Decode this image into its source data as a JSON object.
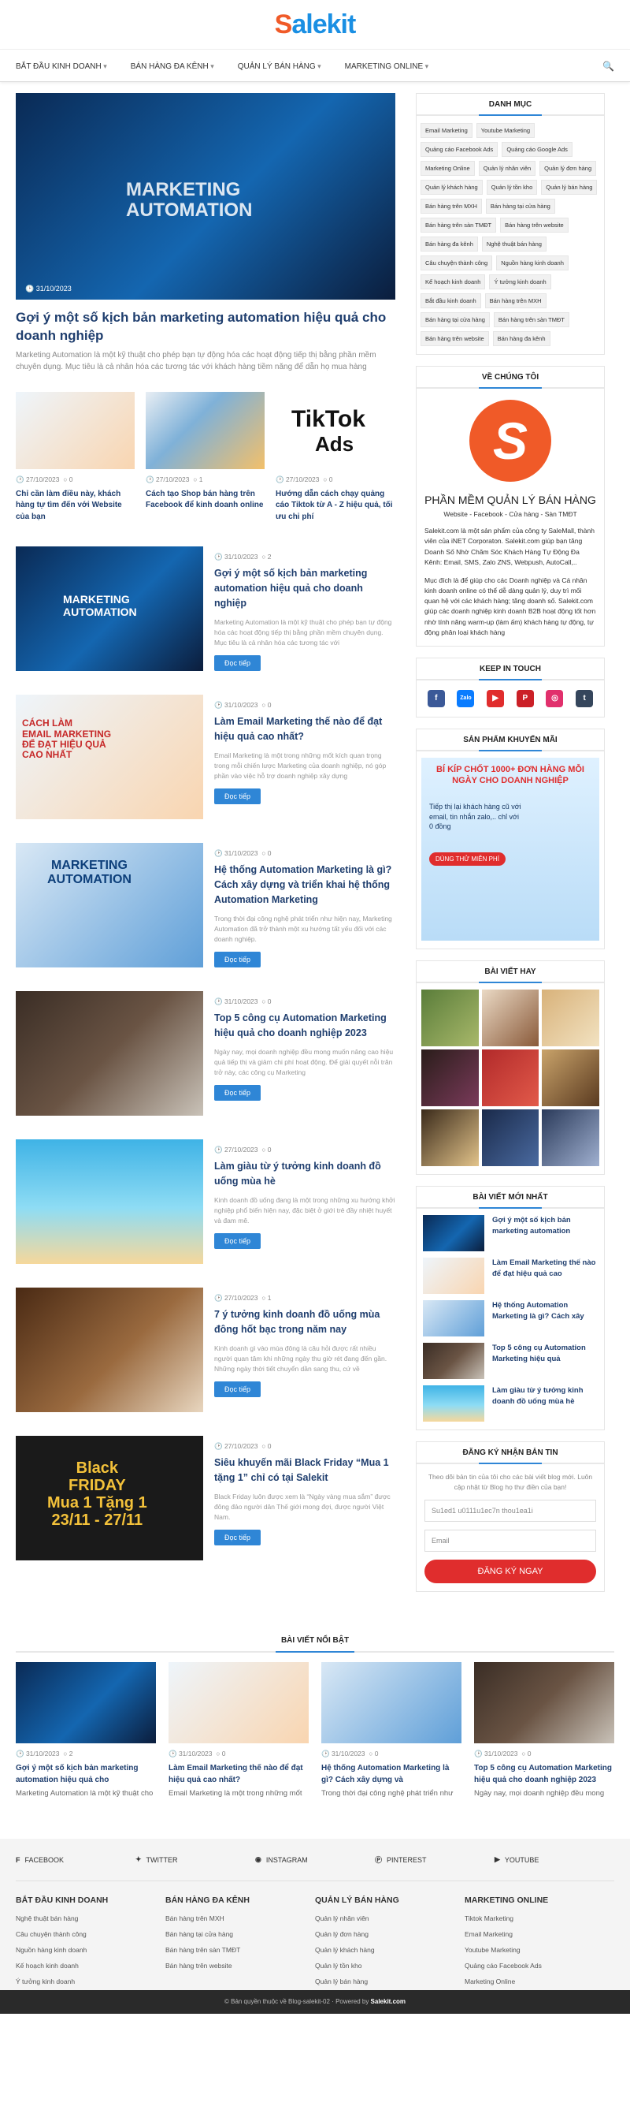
{
  "logo": {
    "part1": "S",
    "part2": "alekit"
  },
  "nav": [
    "BẮT ĐẦU KINH DOANH",
    "BÁN HÀNG ĐA KÊNH",
    "QUẢN LÝ BÁN HÀNG",
    "MARKETING ONLINE"
  ],
  "hero": {
    "date": "31/10/2023",
    "overlay": "MARKETING\nAUTOMATION",
    "title": "Gợi ý một số kịch bản marketing automation hiệu quả cho doanh nghiệp",
    "excerpt": "Marketing Automation là một kỹ thuật cho phép bạn tự động hóa các hoạt động tiếp thị bằng phần mềm chuyên dụng. Mục tiêu là cả nhân hóa các tương tác với khách hàng tiềm năng để dẫn họ mua hàng"
  },
  "small_posts": [
    {
      "date": "27/10/2023",
      "count": "0",
      "title": "Chỉ cần làm điều này, khách hàng tự tìm đến với Website của bạn"
    },
    {
      "date": "27/10/2023",
      "count": "1",
      "title": "Cách tạo Shop bán hàng trên Facebook để kinh doanh online"
    },
    {
      "date": "27/10/2023",
      "count": "0",
      "title": "Hướng dẫn cách chạy quảng cáo Tiktok từ A - Z hiệu quả, tối ưu chi phí"
    }
  ],
  "posts": [
    {
      "date": "31/10/2023",
      "count": "2",
      "title": "Gợi ý một số kịch bản marketing automation hiệu quả cho doanh nghiệp",
      "excerpt": "Marketing Automation là một kỹ thuật cho phép bạn tự động hóa các hoạt động tiếp thị bằng phần mềm chuyên dụng. Mục tiêu là cả nhân hóa các tương tác với",
      "overlay": "MARKETING\nAUTOMATION"
    },
    {
      "date": "31/10/2023",
      "count": "0",
      "title": "Làm Email Marketing thế nào để đạt hiệu quả cao nhất?",
      "excerpt": "Email Marketing là một trong những mốt kích quan trọng trong mỗi chiến lược Marketing của doanh nghiệp, nó góp phần vào việc hỗ trợ doanh nghiệp xây dựng",
      "overlay": "CÁCH LÀM\nEMAIL MARKETING\nĐỂ ĐẠT HIỆU QUẢ\nCAO NHẤT"
    },
    {
      "date": "31/10/2023",
      "count": "0",
      "title": "Hệ thống Automation Marketing là gì? Cách xây dựng và triển khai hệ thống Automation Marketing",
      "excerpt": "Trong thời đại công nghệ phát triển như hiện nay, Marketing Automation đã trở thành một xu hướng tất yếu đối với các doanh nghiệp.",
      "overlay": "MARKETING\nAUTOMATION"
    },
    {
      "date": "31/10/2023",
      "count": "0",
      "title": "Top 5 công cụ Automation Marketing hiệu quả cho doanh nghiệp 2023",
      "excerpt": "Ngày nay, mọi doanh nghiệp đều mong muốn nâng cao hiệu quả tiếp thị và giảm chi phí hoạt động. Để giải quyết nỗi trăn trở này, các công cụ Marketing",
      "overlay": ""
    },
    {
      "date": "27/10/2023",
      "count": "0",
      "title": "Làm giàu từ ý tưởng kinh doanh đồ uống mùa hè",
      "excerpt": "Kinh doanh đồ uống đang là một trong những xu hướng khởi nghiệp phổ biến hiện nay, đặc biệt ở giới trẻ đầy nhiệt huyết và đam mê.",
      "overlay": ""
    },
    {
      "date": "27/10/2023",
      "count": "1",
      "title": "7 ý tưởng kinh doanh đồ uống mùa đông hốt bạc trong năm nay",
      "excerpt": "Kinh doanh gì vào mùa đông là câu hỏi được rất nhiều người quan tâm khi những ngày thu giờ rét đang đến gần. Những ngày thời tiết chuyển dần sang thu, cứ về",
      "overlay": ""
    },
    {
      "date": "27/10/2023",
      "count": "0",
      "title": "Siêu khuyến mãi Black Friday “Mua 1 tặng 1” chỉ có tại Salekit",
      "excerpt": "Black Friday luôn được xem là “Ngày vàng mua sắm” được đông đảo người dân Thế giới mong đợi, được người Việt Nam.",
      "overlay": "Black\nFRIDAY\nMua 1 Tặng 1\n23/11 - 27/11"
    }
  ],
  "read_more": "Đọc tiếp",
  "sidebar": {
    "danh_muc": {
      "title": "DANH MỤC",
      "tags": [
        "Email Marketing",
        "Youtube Marketing",
        "Quảng cáo Facebook Ads",
        "Quảng cáo Google Ads",
        "Marketing Online",
        "Quản lý nhân viên",
        "Quản lý đơn hàng",
        "Quản lý khách hàng",
        "Quản lý tồn kho",
        "Quản lý bán hàng",
        "Bán hàng trên MXH",
        "Bán hàng tại cửa hàng",
        "Bán hàng trên sàn TMĐT",
        "Bán hàng trên website",
        "Bán hàng đa kênh",
        "Nghệ thuật bán hàng",
        "Câu chuyện thành công",
        "Nguồn hàng kinh doanh",
        "Kế hoạch kinh doanh",
        "Ý tưởng kinh doanh",
        "Bắt đầu kinh doanh",
        "Bán hàng trên MXH",
        "Bán hàng tại cửa hàng",
        "Bán hàng trên sàn TMĐT",
        "Bán hàng trên website",
        "Bán hàng đa kênh"
      ]
    },
    "ve_chung_toi": {
      "title": "VỀ CHÚNG TÔI",
      "name": "PHẦN MỀM QUẢN LÝ BÁN HÀNG",
      "sub": "Website - Facebook - Cửa hàng - Sàn TMĐT",
      "p1": "Salekit.com là một sản phẩm của công ty SaleMall, thành viên của iNET Corporaton. Salekit.com giúp bạn tăng Doanh Số Nhờ Chăm Sóc Khách Hàng Tự Động Đa Kênh: Email, SMS, Zalo ZNS, Webpush, AutoCall,..",
      "p2": "Mục đích là để giúp cho các Doanh nghiệp và Cá nhân kinh doanh online có thể dễ dàng quản lý, duy trì mối quan hệ với các khách hàng; tăng doanh số. Salekit.com giúp các doanh nghiệp kinh doanh B2B hoạt động tốt hơn nhờ tính năng warm-up (làm ấm) khách hàng tự động, tự động phân loại khách hàng"
    },
    "keep_in_touch": {
      "title": "KEEP IN TOUCH",
      "icons": [
        "f",
        "Zalo",
        "▶",
        "P",
        "◎",
        "t"
      ]
    },
    "khuyen_mai": {
      "title": "SẢN PHẨM KHUYẾN MÃI",
      "line1": "BÍ KÍP CHỐT 1000+ ĐƠN HÀNG MỖI NGÀY CHO DOANH NGHIỆP",
      "line2": "Tiếp thị lại khách hàng cũ với email, tin nhắn zalo,.. chỉ với 0 đồng",
      "btn": "DÙNG THỬ MIỄN PHÍ"
    },
    "bai_viet_hay": {
      "title": "BÀI VIẾT HAY"
    },
    "bai_viet_moi": {
      "title": "BÀI VIẾT MỚI NHẤT",
      "items": [
        "Gợi ý một số kịch bản marketing automation",
        "Làm Email Marketing thế nào để đạt hiệu quả cao",
        "Hệ thống Automation Marketing là gì? Cách xây",
        "Top 5 công cụ Automation Marketing hiệu quả",
        "Làm giàu từ ý tưởng kinh doanh đồ uống mùa hè"
      ]
    },
    "dang_ky": {
      "title": "ĐĂNG KÝ NHẬN BẢN TIN",
      "text": "Theo dõi bản tin của tôi cho các bài viết blog mới. Luôn cập nhật từ Blog họ thư điền của bạn!",
      "name_ph": "Su1ed1 u0111u1ec7n thou1ea1i",
      "email_ph": "Email",
      "btn": "ĐĂNG KÝ NGAY"
    }
  },
  "featured": {
    "title": "BÀI VIẾT NỔI BẬT",
    "items": [
      {
        "date": "31/10/2023",
        "count": "2",
        "title": "Gợi ý một số kịch bản marketing automation hiệu quả cho",
        "excerpt": "Marketing Automation là một kỹ thuật cho phép bạn tự động hóa các"
      },
      {
        "date": "31/10/2023",
        "count": "0",
        "title": "Làm Email Marketing thế nào để đạt hiệu quả cao nhất?",
        "excerpt": "Email Marketing là một trong những mốt kích quan trọng trong mỗi chiến"
      },
      {
        "date": "31/10/2023",
        "count": "0",
        "title": "Hệ thống Automation Marketing là gì? Cách xây dựng và",
        "excerpt": "Trong thời đại công nghệ phát triển như hiện nay, Marketing Automation"
      },
      {
        "date": "31/10/2023",
        "count": "0",
        "title": "Top 5 công cụ Automation Marketing hiệu quả cho doanh nghiệp 2023",
        "excerpt": "Ngày nay, mọi doanh nghiệp đều mong muốn nâng cao hiệu quả tiếp thị"
      }
    ]
  },
  "footer": {
    "social": [
      "FACEBOOK",
      "TWITTER",
      "INSTAGRAM",
      "PINTEREST",
      "YOUTUBE"
    ],
    "cols": [
      {
        "title": "BẮT ĐẦU KINH DOANH",
        "links": [
          "Nghệ thuật bán hàng",
          "Câu chuyện thành công",
          "Nguồn hàng kinh doanh",
          "Kế hoạch kinh doanh",
          "Ý tưởng kinh doanh"
        ]
      },
      {
        "title": "BÁN HÀNG ĐA KÊNH",
        "links": [
          "Bán hàng trên MXH",
          "Bán hàng tại cửa hàng",
          "Bán hàng trên sàn TMĐT",
          "Bán hàng trên website"
        ]
      },
      {
        "title": "QUẢN LÝ BÁN HÀNG",
        "links": [
          "Quản lý nhân viên",
          "Quản lý đơn hàng",
          "Quản lý khách hàng",
          "Quản lý tồn kho",
          "Quản lý bán hàng"
        ]
      },
      {
        "title": "MARKETING ONLINE",
        "links": [
          "Tiktok Marketing",
          "Email Marketing",
          "Youtube Marketing",
          "Quảng cáo Facebook Ads",
          "Marketing Online"
        ]
      }
    ],
    "copyright": "© Bản quyền thuộc về Blog-salekit-02 · Powered by",
    "powered": "Salekit.com"
  },
  "colors": {
    "primary": "#2f86d6",
    "accent": "#f05a28",
    "title": "#1f3e6e",
    "red": "#e02d2d"
  }
}
